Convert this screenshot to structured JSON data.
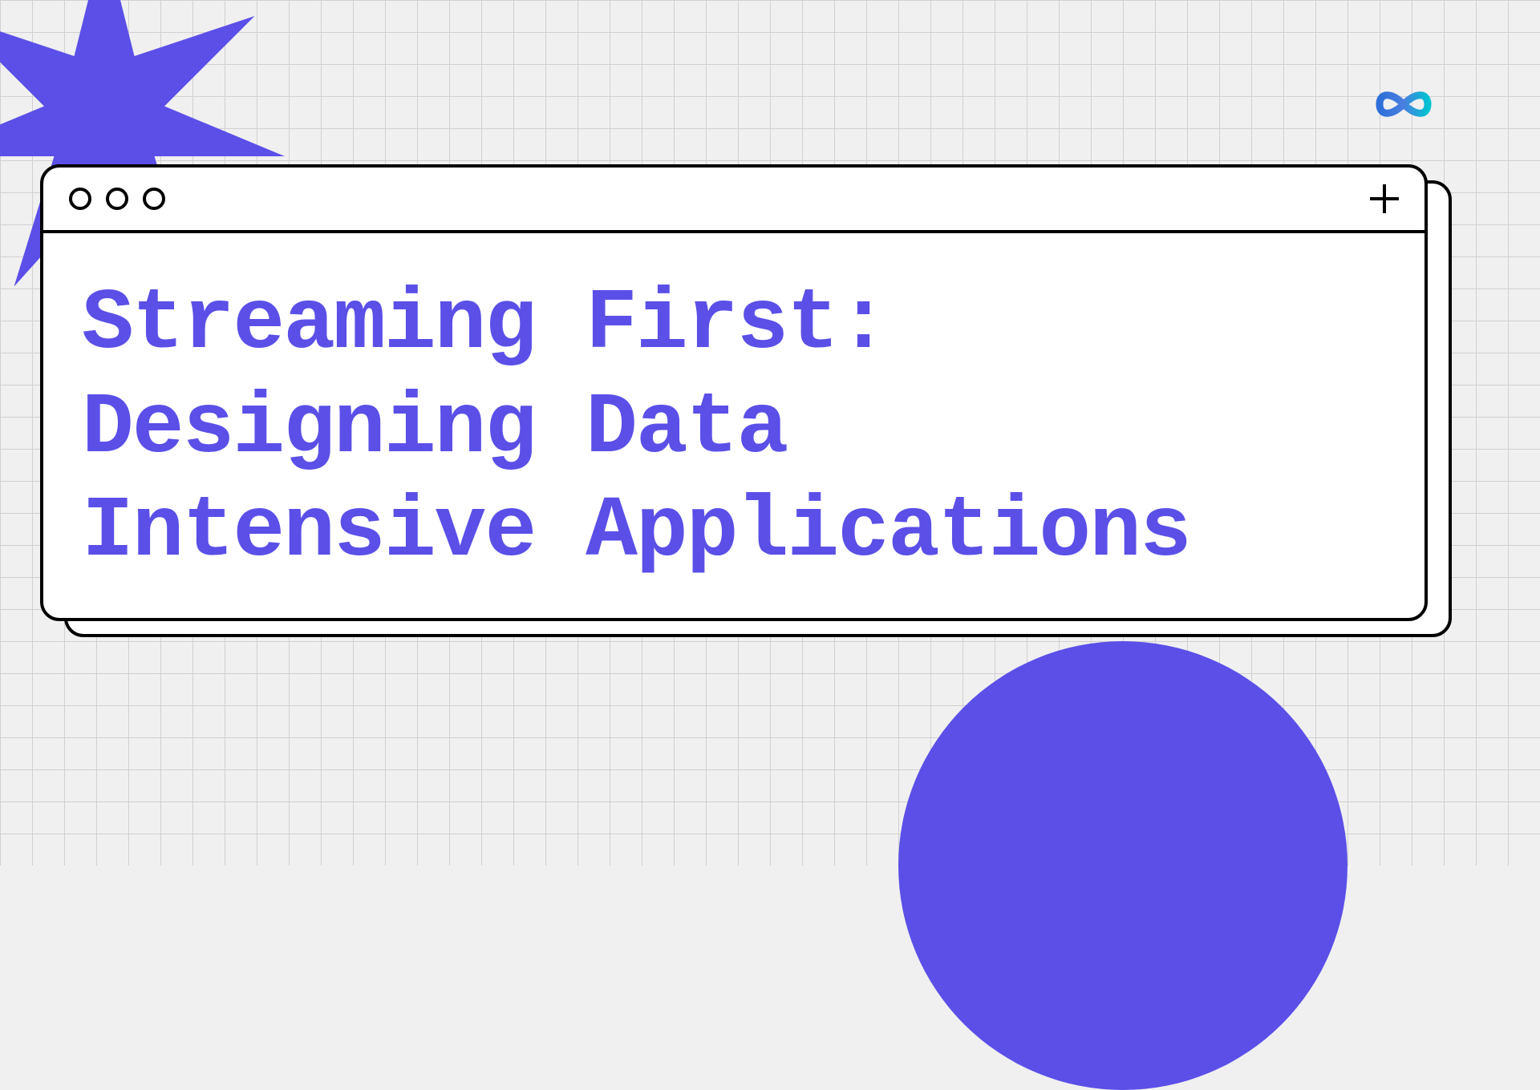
{
  "slide": {
    "title": "Streaming First:\nDesigning Data\nIntensive Applications"
  },
  "colors": {
    "accent": "#5B4FE8",
    "logo_start": "#2E6FD9",
    "logo_end": "#00C2D1"
  }
}
